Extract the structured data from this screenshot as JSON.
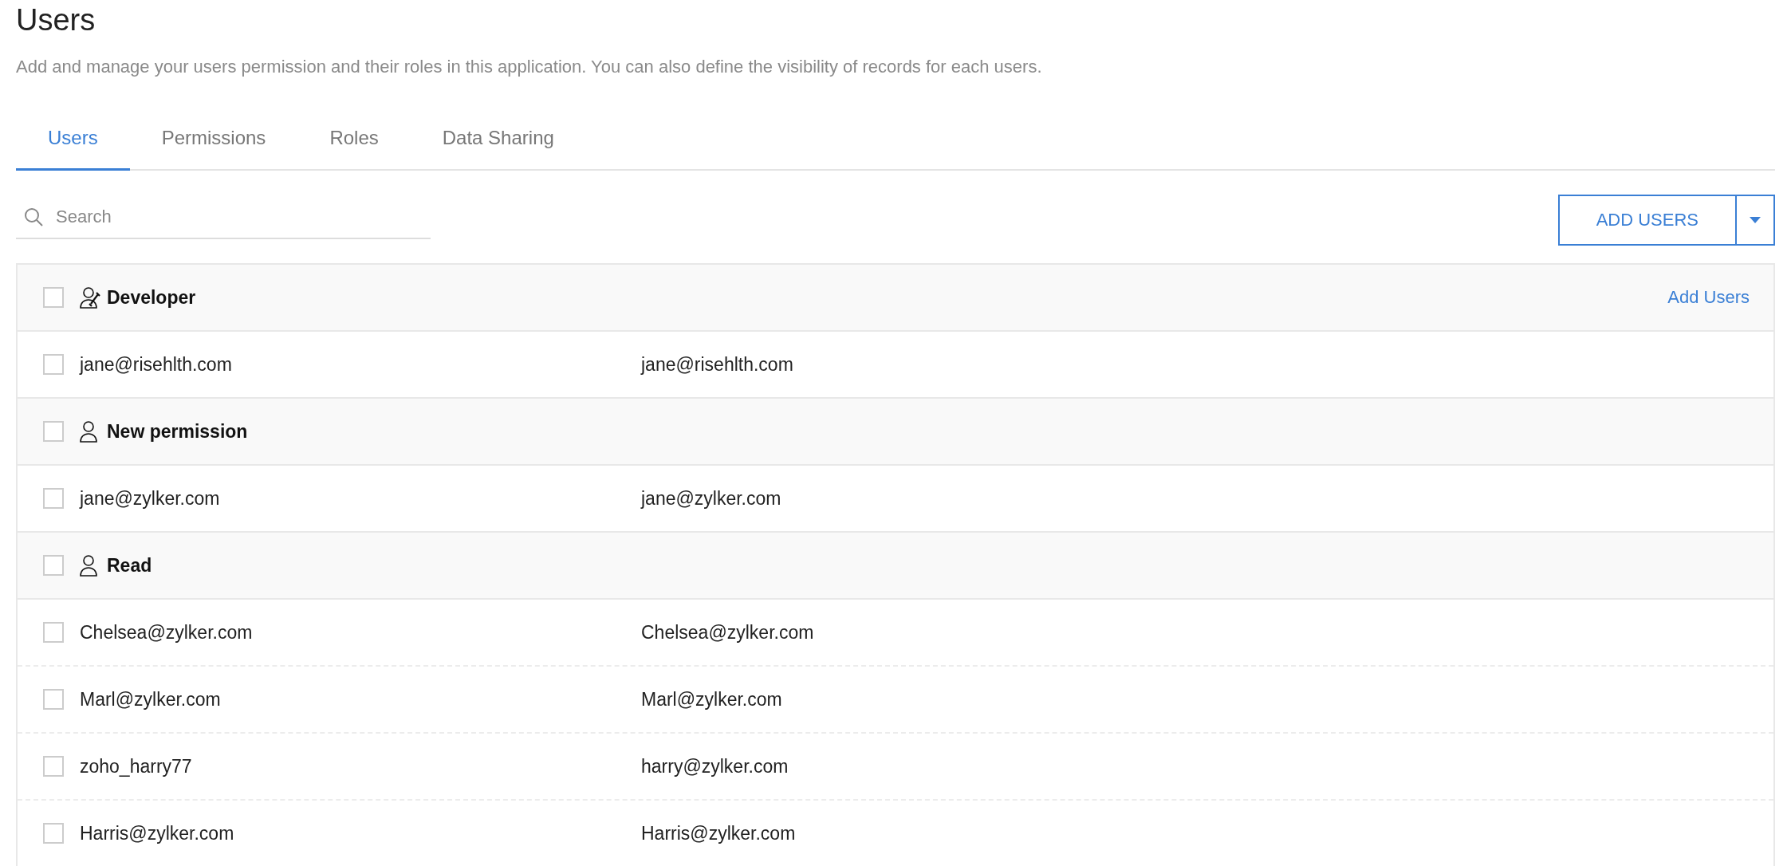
{
  "header": {
    "title": "Users",
    "description": "Add and manage your users permission and their roles in this application. You can also define the visibility of records for each users."
  },
  "tabs": [
    {
      "label": "Users",
      "selected": true
    },
    {
      "label": "Permissions",
      "selected": false
    },
    {
      "label": "Roles",
      "selected": false
    },
    {
      "label": "Data Sharing",
      "selected": false
    }
  ],
  "search": {
    "placeholder": "Search"
  },
  "add_button": {
    "label": "ADD USERS"
  },
  "rows": [
    {
      "kind": "tool_group",
      "name": "Developer",
      "checked": false,
      "action": "Add Users"
    },
    {
      "kind": "user",
      "column_1": "jane@risehlth.com",
      "column_2": "jane@risehlth.com",
      "checked": false
    },
    {
      "kind": "group",
      "name": "New permission",
      "checked": false
    },
    {
      "kind": "user",
      "column_1": "jane@zylker.com",
      "column_2": "jane@zylker.com",
      "checked": false
    },
    {
      "kind": "group",
      "name": "Read",
      "checked": false
    },
    {
      "kind": "user",
      "column_1": "Chelsea@zylker.com",
      "column_2": "Chelsea@zylker.com",
      "checked": false
    },
    {
      "kind": "user",
      "column_1": "Marl@zylker.com",
      "column_2": "Marl@zylker.com",
      "checked": false
    },
    {
      "kind": "user",
      "column_1": "zoho_harry77",
      "column_2": "harry@zylker.com",
      "checked": false
    },
    {
      "kind": "user",
      "column_1": "Harris@zylker.com",
      "column_2": "Harris@zylker.com",
      "checked": false
    }
  ]
}
